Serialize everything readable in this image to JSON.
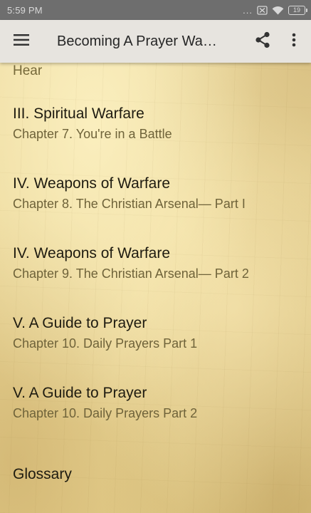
{
  "status_bar": {
    "time": "5:59 PM",
    "dots": "...",
    "battery_level": "19"
  },
  "app_bar": {
    "title": "Becoming A Prayer Wa…",
    "icons": {
      "menu": "hamburger-menu-icon",
      "share": "share-icon",
      "more": "overflow-menu-icon"
    }
  },
  "colors": {
    "status_bar_bg": "#6e6e6e",
    "app_bar_bg": "#e7e4df",
    "parchment": "#ecd99c",
    "title_text": "#1e1b10",
    "subtitle_text": "#6f633a"
  },
  "content": {
    "partial_line": "Hear",
    "items": [
      {
        "title": "III. Spiritual Warfare",
        "subtitle": "Chapter 7. You're in a Battle"
      },
      {
        "title": "IV. Weapons of Warfare",
        "subtitle": "Chapter 8. The Christian Arsenal— Part I"
      },
      {
        "title": "IV. Weapons of Warfare",
        "subtitle": "Chapter 9. The Christian Arsenal— Part 2"
      },
      {
        "title": "V. A Guide to Prayer",
        "subtitle": "Chapter 10. Daily Prayers Part 1"
      },
      {
        "title": "V. A Guide to Prayer",
        "subtitle": "Chapter 10. Daily Prayers Part 2"
      },
      {
        "title": "Glossary"
      }
    ]
  }
}
